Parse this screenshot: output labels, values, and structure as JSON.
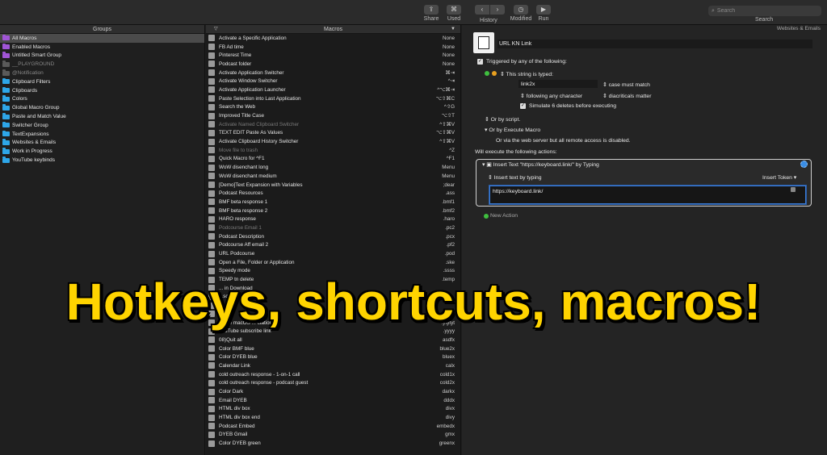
{
  "toolbar": {
    "share": "Share",
    "used": "Used",
    "history": "History",
    "modified": "Modified",
    "run": "Run",
    "search_placeholder": "Search",
    "search_label": "Search"
  },
  "groups": {
    "header": "Groups",
    "items": [
      {
        "label": "All Macros",
        "color": "#a055d6"
      },
      {
        "label": "Enabled Macros",
        "color": "#a055d6"
      },
      {
        "label": "Untitled Smart Group",
        "color": "#a055d6"
      },
      {
        "label": "__PLAYGROUND",
        "color": "#5a5a5a"
      },
      {
        "label": "@Notification",
        "color": "#5a5a5a"
      },
      {
        "label": "Clipboard Filters",
        "color": "#2ea6e8"
      },
      {
        "label": "Clipboards",
        "color": "#2ea6e8"
      },
      {
        "label": "Colors",
        "color": "#2ea6e8"
      },
      {
        "label": "Global Macro Group",
        "color": "#2ea6e8"
      },
      {
        "label": "Paste and Match Value",
        "color": "#2ea6e8"
      },
      {
        "label": "Switcher Group",
        "color": "#2ea6e8"
      },
      {
        "label": "TextExpansions",
        "color": "#2ea6e8"
      },
      {
        "label": "Websites & Emails",
        "color": "#2ea6e8"
      },
      {
        "label": "Work in Progress",
        "color": "#2ea6e8"
      },
      {
        "label": "YouTube keybinds",
        "color": "#2ea6e8"
      }
    ]
  },
  "macros": {
    "header": "Macros",
    "items": [
      {
        "name": "Activate a Specific Application",
        "trigger": "None"
      },
      {
        "name": "FB Ad time",
        "trigger": "None"
      },
      {
        "name": "Pinterest Time",
        "trigger": "None"
      },
      {
        "name": "Podcast folder",
        "trigger": "None"
      },
      {
        "name": "Activate Application Switcher",
        "trigger": "⌘⇥"
      },
      {
        "name": "Activate Window Switcher",
        "trigger": "^⇥"
      },
      {
        "name": "Activate Application Launcher",
        "trigger": "^⌥⌘⇥"
      },
      {
        "name": "Paste Selection into Last Application",
        "trigger": "⌥⇧⌘C"
      },
      {
        "name": "Search the Web",
        "trigger": "^⇧G"
      },
      {
        "name": "Improved Title Case",
        "trigger": "⌥⇧T"
      },
      {
        "name": "Activate Named Clipboard Switcher",
        "trigger": "^⇧⌘V"
      },
      {
        "name": "TEXT EDIT Paste As Values",
        "trigger": "⌥⇧⌘V"
      },
      {
        "name": "Activate Clipboard History Switcher",
        "trigger": "^⇧⌘V"
      },
      {
        "name": "Move file to trash",
        "trigger": "^Z"
      },
      {
        "name": "Quick Macro for ^F1",
        "trigger": "^F1"
      },
      {
        "name": "WoW disenchant long",
        "trigger": "Menu"
      },
      {
        "name": "WoW disenchant medium",
        "trigger": "Menu"
      },
      {
        "name": "[Demo]Text Expansion with Variables",
        "trigger": ";dear"
      },
      {
        "name": "Podcast Resources",
        "trigger": ".ass"
      },
      {
        "name": "BMF beta response 1",
        "trigger": ".bmf1"
      },
      {
        "name": "BMF beta response 2",
        "trigger": ".bmf2"
      },
      {
        "name": "HARO response",
        "trigger": ".haro"
      },
      {
        "name": "Podcourse Email 1",
        "trigger": ".pc2"
      },
      {
        "name": "Podcast Description",
        "trigger": ".pcx"
      },
      {
        "name": "Podcourse Aff email 2",
        "trigger": ".pf2"
      },
      {
        "name": "URL Podcourse",
        "trigger": ".pod"
      },
      {
        "name": "Open a File, Folder or Application",
        "trigger": ".ske"
      },
      {
        "name": "Speedy mode",
        "trigger": ".ssss"
      },
      {
        "name": "TEMP tn delete",
        "trigger": ".temp"
      },
      {
        "name": "... in Download",
        "trigger": ""
      },
      {
        "name": "...scription Keebi",
        "trigger": ""
      },
      {
        "name": "",
        "trigger": ""
      },
      {
        "name": "",
        "trigger": ""
      },
      {
        "name": "Close macOS ... ctations",
        "trigger": ".ytytyt"
      },
      {
        "name": "YouTube subscribe link",
        "trigger": ".yyyy"
      },
      {
        "name": "08)Quit all",
        "trigger": "asdfx"
      },
      {
        "name": "Color BMF blue",
        "trigger": "blue2x"
      },
      {
        "name": "Color DYEB blue",
        "trigger": "bluex"
      },
      {
        "name": "Calendar Link",
        "trigger": "calx"
      },
      {
        "name": "cold outreach response - 1-on-1 call",
        "trigger": "cold1x"
      },
      {
        "name": "cold outreach response - podcast guest",
        "trigger": "cold2x"
      },
      {
        "name": "Color Dark",
        "trigger": "darkx"
      },
      {
        "name": "Email DYEB",
        "trigger": "dddx"
      },
      {
        "name": "HTML div box",
        "trigger": "divx"
      },
      {
        "name": "HTML div box end",
        "trigger": "divy"
      },
      {
        "name": "Podcast Embed",
        "trigger": "embedx"
      },
      {
        "name": "DYEB Gmail",
        "trigger": "gmx"
      },
      {
        "name": "Color DYEB green",
        "trigger": "greenx"
      }
    ],
    "dimmed": [
      10,
      13,
      22
    ]
  },
  "editor": {
    "breadcrumb": "Websites & Emails",
    "macro_name": "URL KN Link",
    "triggered_label": "Triggered by any of the following:",
    "string_typed_label": "This string is typed:",
    "typed_string": "link2x",
    "case_option": "case must match",
    "following_option": "following any character",
    "diacriticals_option": "diacriticals matter",
    "simulate_label": "Simulate 6 deletes before executing",
    "or_script": "Or by script.",
    "or_execute_macro": "Or by Execute Macro",
    "web_server_note": "Or via the web server but all remote access is disabled.",
    "will_execute": "Will execute the following actions:",
    "action_title": "Insert Text \"https://keyboard.link/\" by Typing",
    "insert_text_mode": "Insert text by typing",
    "insert_token": "Insert Token",
    "action_text": "https://keyboard.link/",
    "new_action": "New Action"
  },
  "banner": {
    "text": "Hotkeys, shortcuts, macros!"
  }
}
